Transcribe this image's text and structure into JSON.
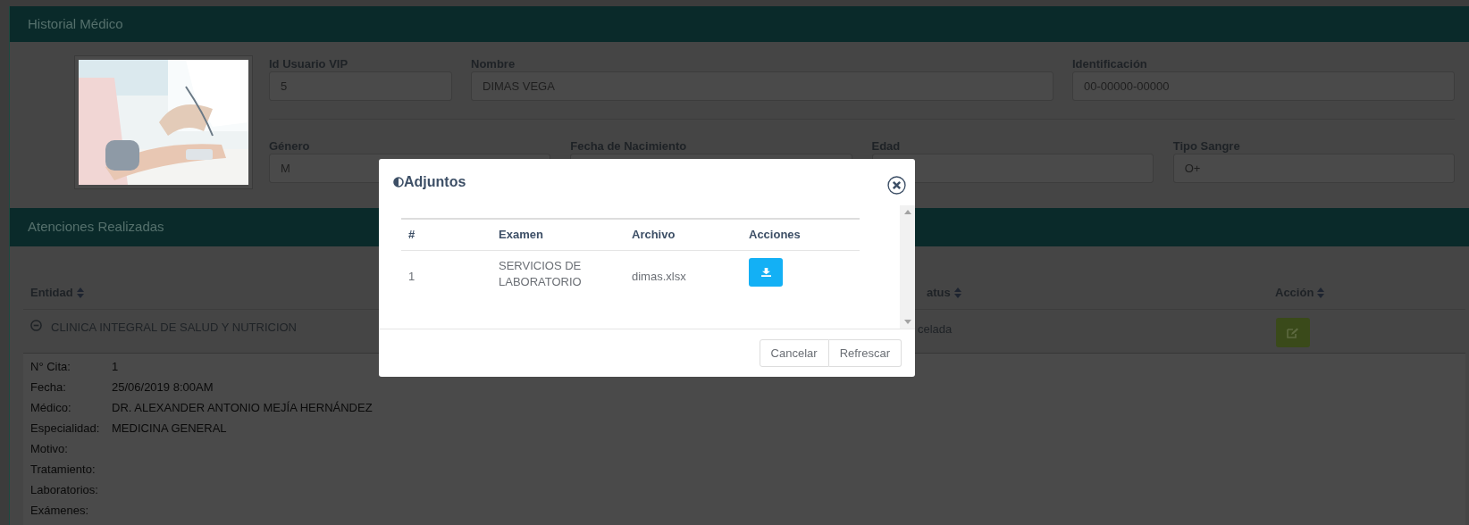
{
  "panel_title": "Historial Médico",
  "profile": {
    "fields_row_1": [
      {
        "label": "Id Usuario VIP",
        "value": "5"
      },
      {
        "label": "Nombre",
        "value": "DIMAS VEGA"
      },
      {
        "label": "Identificación",
        "value": "00-00000-00000"
      }
    ],
    "fields_row_2": [
      {
        "label": "Género",
        "value": "M"
      },
      {
        "label": "Fecha de Nacimiento"
      },
      {
        "label": "Edad"
      },
      {
        "label": "Tipo Sangre",
        "value": "O+"
      }
    ]
  },
  "section_title": "Atenciones Realizadas",
  "table": {
    "columns": [
      {
        "label": "Entidad"
      },
      {
        "label": "atus"
      },
      {
        "label": "Acción"
      }
    ],
    "rows": [
      {
        "expanded": true,
        "entidad": "CLINICA INTEGRAL DE SALUD Y NUTRICION",
        "status": "celada",
        "details": [
          {
            "label": "N° Cita:",
            "value": "1"
          },
          {
            "label": "Fecha:",
            "value": "25/06/2019 8:00AM"
          },
          {
            "label": "Médico:",
            "value": "DR. ALEXANDER ANTONIO MEJÍA HERNÁNDEZ"
          },
          {
            "label": "Especialidad:",
            "value": "MEDICINA GENERAL"
          },
          {
            "label": "Motivo:"
          },
          {
            "label": "Tratamiento:"
          },
          {
            "label": "Laboratorios:"
          },
          {
            "label": "Exámenes:"
          }
        ]
      }
    ]
  },
  "modal": {
    "title": "Adjuntos",
    "columns": [
      "#",
      "Examen",
      "Archivo",
      "Acciones"
    ],
    "rows": [
      {
        "number": "1",
        "examen": "SERVICIOS DE LABORATORIO",
        "archivo": "dimas.xlsx"
      }
    ],
    "buttons": [
      "Cancelar",
      "Refrescar"
    ]
  }
}
